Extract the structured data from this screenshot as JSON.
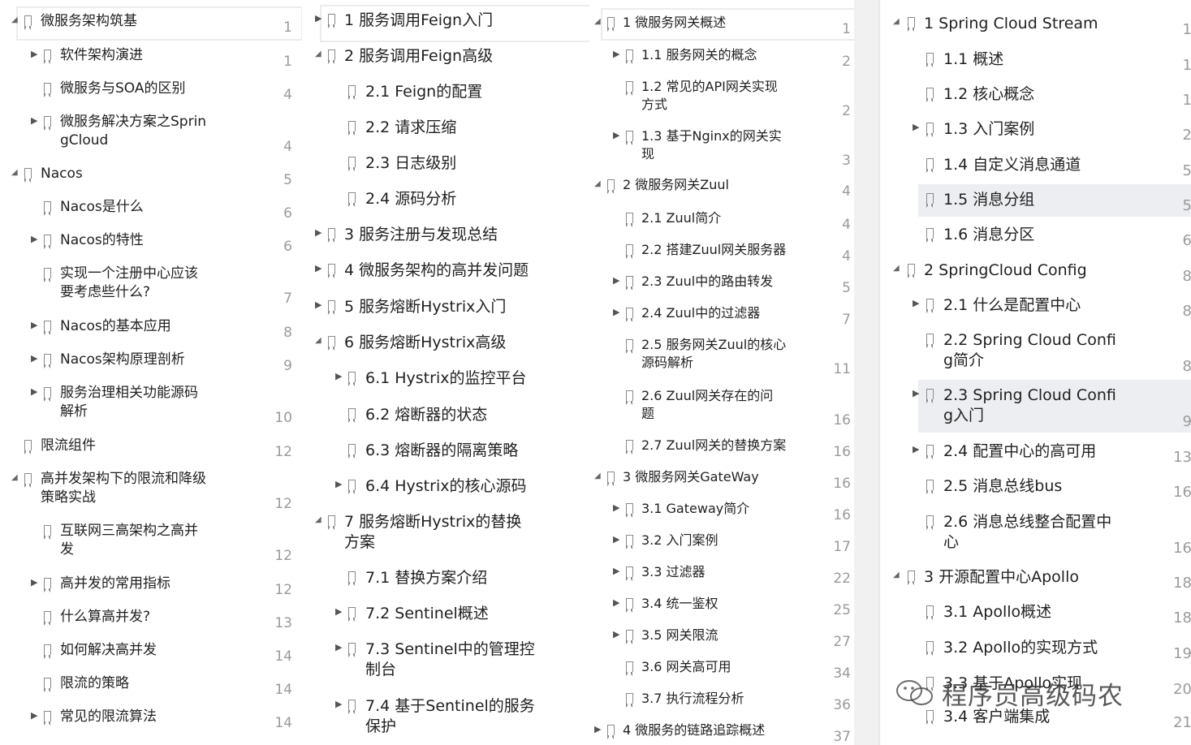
{
  "columns": [
    {
      "id": "c1",
      "items": [
        {
          "label": "微服务架构筑基",
          "page": "1",
          "expand": "open",
          "indent": 0,
          "frame": true
        },
        {
          "label": "软件架构演进",
          "page": "1",
          "expand": "closed",
          "indent": 1
        },
        {
          "label": "微服务与SOA的区别",
          "page": "4",
          "expand": "none",
          "indent": 1
        },
        {
          "label": "微服务解决方案之Sprin\ngCloud",
          "page": "4",
          "expand": "closed",
          "indent": 1
        },
        {
          "label": "Nacos",
          "page": "5",
          "expand": "open",
          "indent": 0
        },
        {
          "label": "Nacos是什么",
          "page": "6",
          "expand": "none",
          "indent": 1
        },
        {
          "label": "Nacos的特性",
          "page": "6",
          "expand": "closed",
          "indent": 1
        },
        {
          "label": "实现一个注册中心应该\n要考虑些什么?",
          "page": "7",
          "expand": "none",
          "indent": 1
        },
        {
          "label": "Nacos的基本应用",
          "page": "8",
          "expand": "closed",
          "indent": 1
        },
        {
          "label": "Nacos架构原理剖析",
          "page": "9",
          "expand": "closed",
          "indent": 1
        },
        {
          "label": "服务治理相关功能源码\n解析",
          "page": "10",
          "expand": "closed",
          "indent": 1
        },
        {
          "label": "限流组件",
          "page": "12",
          "expand": "none",
          "indent": 0
        },
        {
          "label": "高并发架构下的限流和降级\n策略实战",
          "page": "12",
          "expand": "open",
          "indent": 0
        },
        {
          "label": "互联网三高架构之高并\n发",
          "page": "12",
          "expand": "none",
          "indent": 1
        },
        {
          "label": "高并发的常用指标",
          "page": "12",
          "expand": "closed",
          "indent": 1
        },
        {
          "label": "什么算高并发?",
          "page": "13",
          "expand": "none",
          "indent": 1
        },
        {
          "label": "如何解决高并发",
          "page": "14",
          "expand": "none",
          "indent": 1
        },
        {
          "label": "限流的策略",
          "page": "14",
          "expand": "none",
          "indent": 1
        },
        {
          "label": "常见的限流算法",
          "page": "14",
          "expand": "closed",
          "indent": 1
        }
      ]
    },
    {
      "id": "c2",
      "items": [
        {
          "label": "1 服务调用Feign入门",
          "page": "",
          "expand": "closed",
          "indent": 0,
          "frame": true
        },
        {
          "label": "2 服务调用Feign高级",
          "page": "",
          "expand": "open",
          "indent": 0
        },
        {
          "label": "2.1 Feign的配置",
          "page": "",
          "expand": "none",
          "indent": 1
        },
        {
          "label": "2.2 请求压缩",
          "page": "",
          "expand": "none",
          "indent": 1
        },
        {
          "label": "2.3 日志级别",
          "page": "",
          "expand": "none",
          "indent": 1
        },
        {
          "label": "2.4 源码分析",
          "page": "",
          "expand": "none",
          "indent": 1
        },
        {
          "label": "3 服务注册与发现总结",
          "page": "",
          "expand": "closed",
          "indent": 0
        },
        {
          "label": "4 微服务架构的高并发问题",
          "page": "",
          "expand": "closed",
          "indent": 0
        },
        {
          "label": "5 服务熔断Hystrix入门",
          "page": "",
          "expand": "closed",
          "indent": 0
        },
        {
          "label": "6 服务熔断Hystrix高级",
          "page": "",
          "expand": "open",
          "indent": 0
        },
        {
          "label": "6.1 Hystrix的监控平台",
          "page": "",
          "expand": "closed",
          "indent": 1
        },
        {
          "label": "6.2 熔断器的状态",
          "page": "",
          "expand": "none",
          "indent": 1
        },
        {
          "label": "6.3 熔断器的隔离策略",
          "page": "",
          "expand": "none",
          "indent": 1
        },
        {
          "label": "6.4 Hystrix的核心源码",
          "page": "",
          "expand": "closed",
          "indent": 1
        },
        {
          "label": "7 服务熔断Hystrix的替换\n方案",
          "page": "",
          "expand": "open",
          "indent": 0
        },
        {
          "label": "7.1 替换方案介绍",
          "page": "",
          "expand": "none",
          "indent": 1
        },
        {
          "label": "7.2 Sentinel概述",
          "page": "",
          "expand": "closed",
          "indent": 1
        },
        {
          "label": "7.3 Sentinel中的管理控\n制台",
          "page": "",
          "expand": "closed",
          "indent": 1
        },
        {
          "label": "7.4 基于Sentinel的服务\n保护",
          "page": "",
          "expand": "closed",
          "indent": 1
        }
      ]
    },
    {
      "id": "c3",
      "items": [
        {
          "label": "1 微服务网关概述",
          "page": "1",
          "expand": "open",
          "indent": 0,
          "frame": true
        },
        {
          "label": "1.1 服务网关的概念",
          "page": "2",
          "expand": "closed",
          "indent": 1
        },
        {
          "label": "1.2 常见的API网关实现\n方式",
          "page": "2",
          "expand": "none",
          "indent": 1
        },
        {
          "label": "1.3 基于Nginx的网关实\n现",
          "page": "3",
          "expand": "closed",
          "indent": 1
        },
        {
          "label": "2 微服务网关Zuul",
          "page": "4",
          "expand": "open",
          "indent": 0
        },
        {
          "label": "2.1 Zuul简介",
          "page": "4",
          "expand": "none",
          "indent": 1
        },
        {
          "label": "2.2 搭建Zuul网关服务器",
          "page": "4",
          "expand": "none",
          "indent": 1
        },
        {
          "label": "2.3 Zuul中的路由转发",
          "page": "5",
          "expand": "closed",
          "indent": 1
        },
        {
          "label": "2.4 Zuul中的过滤器",
          "page": "7",
          "expand": "closed",
          "indent": 1
        },
        {
          "label": "2.5 服务网关Zuul的核心\n源码解析",
          "page": "11",
          "expand": "none",
          "indent": 1
        },
        {
          "label": "2.6  Zuul网关存在的问\n题",
          "page": "16",
          "expand": "none",
          "indent": 1
        },
        {
          "label": "2.7 Zuul网关的替换方案",
          "page": "16",
          "expand": "none",
          "indent": 1
        },
        {
          "label": "3 微服务网关GateWay",
          "page": "16",
          "expand": "open",
          "indent": 0
        },
        {
          "label": "3.1 Gateway简介",
          "page": "16",
          "expand": "closed",
          "indent": 1
        },
        {
          "label": "3.2 入门案例",
          "page": "17",
          "expand": "closed",
          "indent": 1
        },
        {
          "label": "3.3 过滤器",
          "page": "22",
          "expand": "closed",
          "indent": 1
        },
        {
          "label": "3.4 统一鉴权",
          "page": "25",
          "expand": "closed",
          "indent": 1
        },
        {
          "label": "3.5 网关限流",
          "page": "27",
          "expand": "closed",
          "indent": 1
        },
        {
          "label": "3.6 网关高可用",
          "page": "34",
          "expand": "none",
          "indent": 1
        },
        {
          "label": "3.7 执行流程分析",
          "page": "36",
          "expand": "none",
          "indent": 1
        },
        {
          "label": "4 微服务的链路追踪概述",
          "page": "37",
          "expand": "closed",
          "indent": 0
        }
      ]
    },
    {
      "id": "c4",
      "items": [
        {
          "label": "1 Spring Cloud Stream",
          "page": "1",
          "expand": "open",
          "indent": 0
        },
        {
          "label": "1.1 概述",
          "page": "1",
          "expand": "none",
          "indent": 1
        },
        {
          "label": "1.2 核心概念",
          "page": "1",
          "expand": "none",
          "indent": 1
        },
        {
          "label": "1.3 入门案例",
          "page": "2",
          "expand": "closed",
          "indent": 1
        },
        {
          "label": "1.4 自定义消息通道",
          "page": "5",
          "expand": "none",
          "indent": 1
        },
        {
          "label": "1.5 消息分组",
          "page": "5",
          "expand": "none",
          "indent": 1,
          "selected": true
        },
        {
          "label": "1.6 消息分区",
          "page": "6",
          "expand": "none",
          "indent": 1
        },
        {
          "label": "2 SpringCloud Config",
          "page": "8",
          "expand": "open",
          "indent": 0
        },
        {
          "label": "2.1 什么是配置中心",
          "page": "8",
          "expand": "closed",
          "indent": 1
        },
        {
          "label": "2.2 Spring Cloud Confi\ng简介",
          "page": "8",
          "expand": "none",
          "indent": 1
        },
        {
          "label": "2.3 Spring Cloud Confi\ng入门",
          "page": "9",
          "expand": "closed",
          "indent": 1,
          "selected": true
        },
        {
          "label": "2.4 配置中心的高可用",
          "page": "13",
          "expand": "closed",
          "indent": 1
        },
        {
          "label": "2.5 消息总线bus",
          "page": "16",
          "expand": "none",
          "indent": 1
        },
        {
          "label": "2.6 消息总线整合配置中\n心",
          "page": "16",
          "expand": "none",
          "indent": 1
        },
        {
          "label": "3 开源配置中心Apollo",
          "page": "18",
          "expand": "open",
          "indent": 0
        },
        {
          "label": "3.1 Apollo概述",
          "page": "18",
          "expand": "none",
          "indent": 1
        },
        {
          "label": "3.2 Apollo的实现方式",
          "page": "19",
          "expand": "none",
          "indent": 1
        },
        {
          "label": "3.3 基于Apollo实现",
          "page": "20",
          "expand": "none",
          "indent": 1
        },
        {
          "label": "3.4 客户端集成",
          "page": "21",
          "expand": "none",
          "indent": 1
        }
      ]
    }
  ],
  "watermark": "程序员高级码农"
}
